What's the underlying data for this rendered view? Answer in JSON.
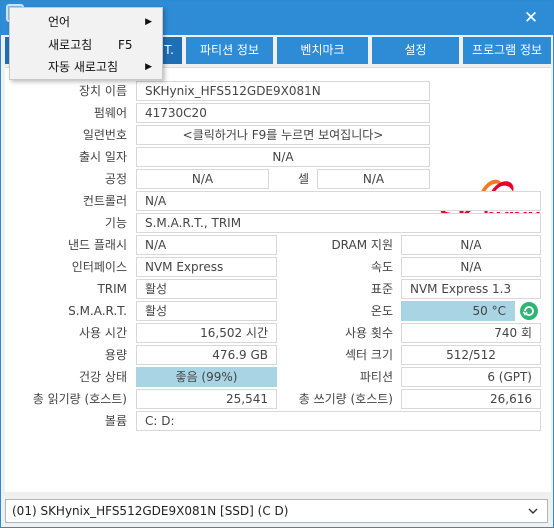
{
  "context_menu": {
    "items": [
      {
        "label": "언어",
        "shortcut": "",
        "submenu": true
      },
      {
        "label": "새로고침",
        "shortcut": "F5",
        "submenu": false
      },
      {
        "label": "자동 새로고침",
        "shortcut": "",
        "submenu": true
      }
    ]
  },
  "tabs": [
    {
      "label": "T."
    },
    {
      "label": "파티션 정보"
    },
    {
      "label": "벤치마크"
    },
    {
      "label": "설정"
    },
    {
      "label": "프로그램 정보"
    }
  ],
  "logo": {
    "sk": "SK",
    "hynix": "hynix",
    "brand_color": "#e4002b",
    "accent": "#f47920"
  },
  "fields": {
    "device_name_label": "장치 이름",
    "device_name": "SKHynix_HFS512GDE9X081N",
    "firmware_label": "펌웨어",
    "firmware": "41730C20",
    "serial_label": "일련번호",
    "serial": "<클릭하거나 F9를 누르면 보여집니다>",
    "release_label": "출시 일자",
    "release": "N/A",
    "process_label": "공정",
    "process": "N/A",
    "cell_label": "셀",
    "cell": "N/A",
    "controller_label": "컨트롤러",
    "controller": "N/A",
    "features_label": "기능",
    "features": "S.M.A.R.T., TRIM",
    "nand_cache_label": "낸드 플래시",
    "nand_cache": "N/A",
    "dram_label": "DRAM 지원",
    "dram": "N/A",
    "interface_label": "인터페이스",
    "interface": "NVM Express",
    "speed_label": "속도",
    "speed": "N/A",
    "trim_label": "TRIM",
    "trim": "활성",
    "standard_label": "표준",
    "standard": "NVM Express 1.3",
    "smart_label": "S.M.A.R.T.",
    "smart": "활성",
    "temp_label": "온도",
    "temp": "50 °C",
    "power_on_label": "사용 시간",
    "power_on": "16,502 시간",
    "power_count_label": "사용 횟수",
    "power_count": "740 회",
    "capacity_label": "용량",
    "capacity": "476.9 GB",
    "sector_label": "섹터 크기",
    "sector": "512/512",
    "health_label": "건강 상태",
    "health": "좋음 (99%)",
    "partition_label": "파티션",
    "partition": "6 (GPT)",
    "reads_label": "총 읽기량 (호스트)",
    "reads": "25,541",
    "writes_label": "총 쓰기량 (호스트)",
    "writes": "26,616",
    "volume_label": "볼륨",
    "volume": "C: D:"
  },
  "drive_selector": {
    "value": "(01) SKHynix_HFS512GDE9X081N [SSD] (C D)"
  },
  "colors": {
    "titlebar": "#2e8bd6",
    "highlight": "#a9d4e3",
    "refresh": "#2bb673"
  }
}
